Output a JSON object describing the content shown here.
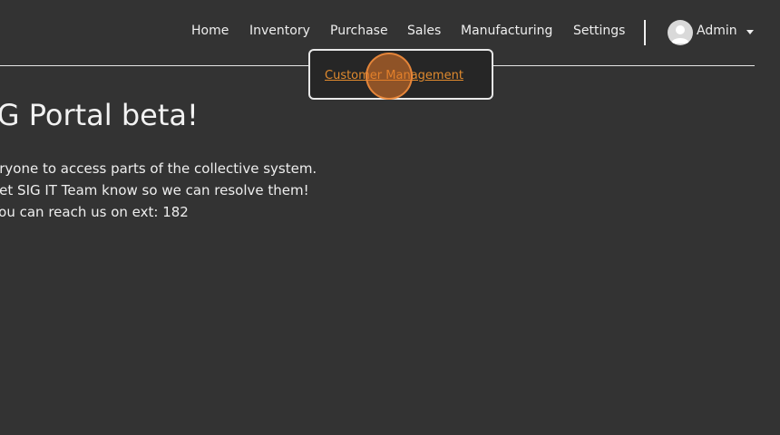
{
  "nav": {
    "items": [
      {
        "label": "Home"
      },
      {
        "label": "Inventory"
      },
      {
        "label": "Purchase"
      },
      {
        "label": "Sales"
      },
      {
        "label": "Manufacturing"
      },
      {
        "label": "Settings"
      }
    ],
    "user_label": "Admin",
    "user_icon": "user-avatar-icon",
    "caret_icon": "caret-down-icon"
  },
  "dropdown": {
    "items": [
      {
        "label": "Customer Management"
      }
    ]
  },
  "main": {
    "title": "to the SIG Portal beta!",
    "lines": [
      "eryone to access parts of the collective system.",
      " let SIG IT Team know so we can resolve them!",
      "You can reach us on ext: 182"
    ]
  },
  "colors": {
    "background": "#333333",
    "link": "#e08a2e",
    "text": "#f2f2f2"
  }
}
